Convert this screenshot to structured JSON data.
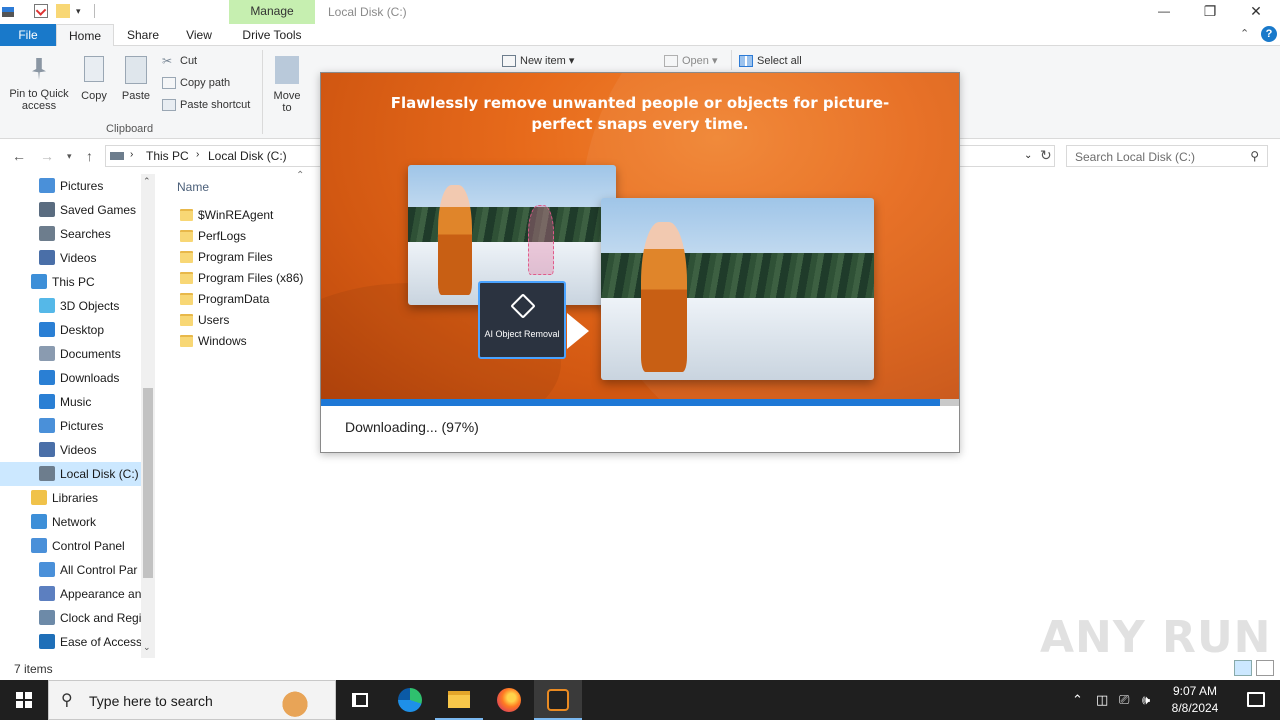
{
  "window": {
    "title": "Local Disk (C:)",
    "manage_tab": "Manage",
    "controls": {
      "minimize": "—",
      "restore": "❐",
      "close": "✕"
    }
  },
  "ribbon_tabs": {
    "file": "File",
    "home": "Home",
    "share": "Share",
    "view": "View",
    "drive_tools": "Drive Tools"
  },
  "ribbon": {
    "pin": "Pin to Quick access",
    "copy": "Copy",
    "paste": "Paste",
    "cut": "Cut",
    "copy_path": "Copy path",
    "paste_shortcut": "Paste shortcut",
    "clipboard_group": "Clipboard",
    "move_to": "Move to",
    "new_item": "New item",
    "open": "Open",
    "select_all": "Select all"
  },
  "address": {
    "crumbs": [
      "This PC",
      "Local Disk (C:)"
    ],
    "search_placeholder": "Search Local Disk (C:)"
  },
  "nav": {
    "items": [
      {
        "label": "Pictures",
        "icon": "pictures-icon",
        "indent": 1,
        "selected": false
      },
      {
        "label": "Saved Games",
        "icon": "saved-games-icon",
        "indent": 1,
        "selected": false
      },
      {
        "label": "Searches",
        "icon": "searches-icon",
        "indent": 1,
        "selected": false
      },
      {
        "label": "Videos",
        "icon": "videos-icon",
        "indent": 1,
        "selected": false
      },
      {
        "label": "This PC",
        "icon": "this-pc-icon",
        "indent": 0,
        "selected": false
      },
      {
        "label": "3D Objects",
        "icon": "3d-objects-icon",
        "indent": 1,
        "selected": false
      },
      {
        "label": "Desktop",
        "icon": "desktop-icon",
        "indent": 1,
        "selected": false
      },
      {
        "label": "Documents",
        "icon": "documents-icon",
        "indent": 1,
        "selected": false
      },
      {
        "label": "Downloads",
        "icon": "downloads-icon",
        "indent": 1,
        "selected": false
      },
      {
        "label": "Music",
        "icon": "music-icon",
        "indent": 1,
        "selected": false
      },
      {
        "label": "Pictures",
        "icon": "pictures-icon",
        "indent": 1,
        "selected": false
      },
      {
        "label": "Videos",
        "icon": "videos-icon",
        "indent": 1,
        "selected": false
      },
      {
        "label": "Local Disk (C:)",
        "icon": "drive-icon",
        "indent": 1,
        "selected": true
      },
      {
        "label": "Libraries",
        "icon": "libraries-icon",
        "indent": 0,
        "selected": false
      },
      {
        "label": "Network",
        "icon": "network-icon",
        "indent": 0,
        "selected": false
      },
      {
        "label": "Control Panel",
        "icon": "control-panel-icon",
        "indent": 0,
        "selected": false
      },
      {
        "label": "All Control Par",
        "icon": "control-panel-icon",
        "indent": 1,
        "selected": false
      },
      {
        "label": "Appearance an",
        "icon": "appearance-icon",
        "indent": 1,
        "selected": false
      },
      {
        "label": "Clock and Regi",
        "icon": "clock-icon",
        "indent": 1,
        "selected": false
      },
      {
        "label": "Ease of Access",
        "icon": "ease-of-access-icon",
        "indent": 1,
        "selected": false
      }
    ]
  },
  "files": {
    "column_name": "Name",
    "items": [
      "$WinREAgent",
      "PerfLogs",
      "Program Files",
      "Program Files (x86)",
      "ProgramData",
      "Users",
      "Windows"
    ]
  },
  "status": {
    "item_count": "7 items"
  },
  "popup": {
    "headline": "Flawlessly remove unwanted people or objects for picture-perfect snaps every time.",
    "badge": "AI Object Removal",
    "progress_text": "Downloading... (97%)",
    "progress": 0.97,
    "accent": "#e76a1b",
    "progress_color": "#1e78d6"
  },
  "watermark": "ANY RUN",
  "taskbar": {
    "search_placeholder": "Type here to search",
    "time": "9:07 AM",
    "date": "8/8/2024"
  }
}
